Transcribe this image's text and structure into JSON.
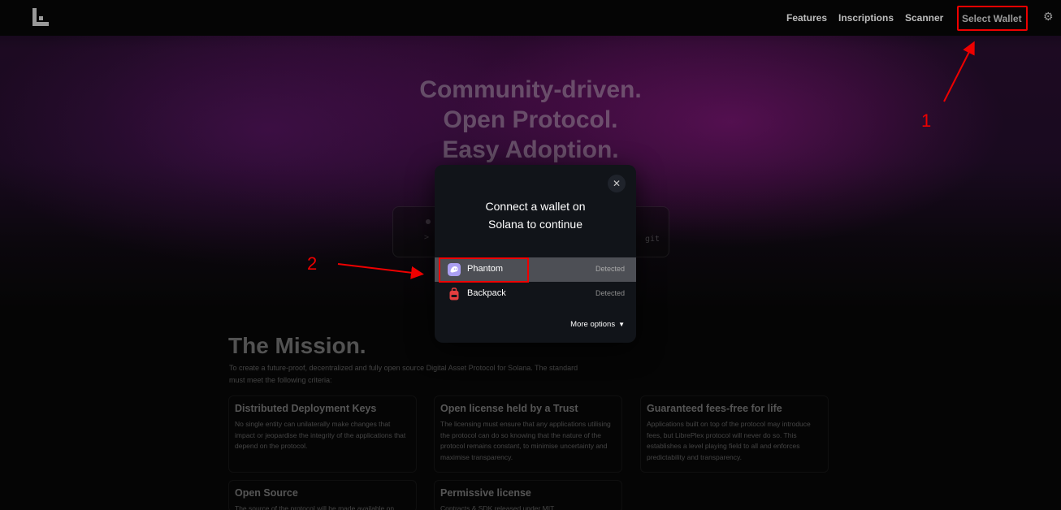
{
  "nav": {
    "links": [
      "Features",
      "Inscriptions",
      "Scanner"
    ],
    "select_wallet": "Select Wallet"
  },
  "hero": {
    "lines": [
      "Community-driven.",
      "Open Protocol.",
      "Easy Adoption."
    ],
    "terminal_tail": "git"
  },
  "mission": {
    "title": "The Mission.",
    "description": "To create a future-proof, decentralized and fully open source Digital Asset Protocol for Solana. The standard must meet the following criteria:",
    "cards": [
      {
        "title": "Distributed Deployment Keys",
        "text": "No single entity can unilaterally make changes that impact or jeopardise the integrity of the applications that depend on the protocol."
      },
      {
        "title": "Open license held by a Trust",
        "text": "The licensing must ensure that any applications utilising the protocol can do so knowing that the nature of the protocol remains constant, to minimise uncertainty and maximise transparency."
      },
      {
        "title": "Guaranteed fees-free for life",
        "text": "Applications built on top of the protocol may introduce fees, but LibrePlex protocol will never do so. This establishes a level playing field to all and enforces predictability and transparency."
      },
      {
        "title": "Open Source",
        "text": "The source of the protocol will be made available on"
      },
      {
        "title": "Permissive license",
        "text": "Contracts & SDK released under MIT."
      }
    ]
  },
  "modal": {
    "title_line1": "Connect a wallet on",
    "title_line2": "Solana to continue",
    "close": "✕",
    "wallets": [
      {
        "name": "Phantom",
        "status": "Detected",
        "color": "#ab9ff2"
      },
      {
        "name": "Backpack",
        "status": "Detected",
        "color": "#e33e3f"
      }
    ],
    "more_options": "More options"
  },
  "annotations": {
    "step1": "1",
    "step2": "2",
    "color": "#ee0000"
  }
}
